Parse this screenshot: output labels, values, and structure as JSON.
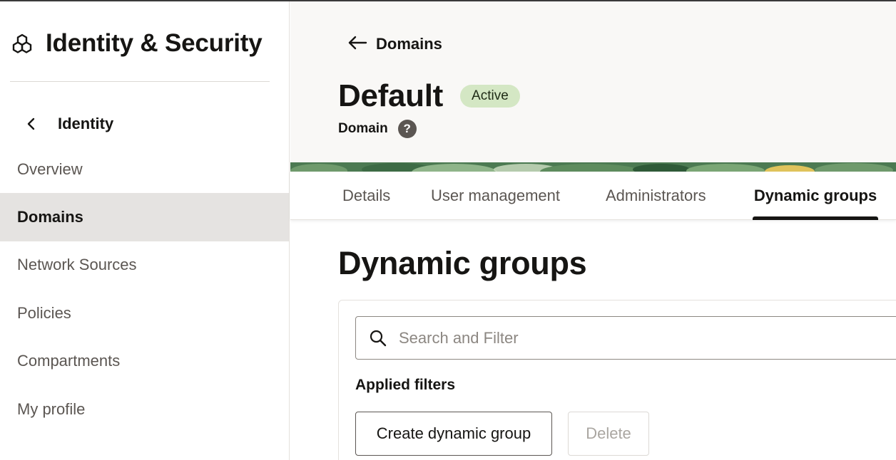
{
  "sidebar": {
    "brand_title": "Identity & Security",
    "brand_icon": "hexagon-cluster-icon",
    "back_label": "Identity",
    "items": [
      {
        "label": "Overview",
        "active": false
      },
      {
        "label": "Domains",
        "active": true
      },
      {
        "label": "Network Sources",
        "active": false
      },
      {
        "label": "Policies",
        "active": false
      },
      {
        "label": "Compartments",
        "active": false
      },
      {
        "label": "My profile",
        "active": false
      }
    ]
  },
  "header": {
    "back_link": "Domains",
    "title": "Default",
    "status": "Active",
    "subtitle": "Domain",
    "help_icon": "?"
  },
  "tabs": [
    {
      "label": "Details",
      "active": false
    },
    {
      "label": "User management",
      "active": false
    },
    {
      "label": "Administrators",
      "active": false
    },
    {
      "label": "Dynamic groups",
      "active": true
    }
  ],
  "section": {
    "title": "Dynamic groups",
    "search_placeholder": "Search and Filter",
    "applied_filters_label": "Applied filters",
    "create_button": "Create dynamic group",
    "delete_button": "Delete"
  },
  "colors": {
    "active_badge": "#d4e7c4",
    "active_nav_bg": "#e5e3e1",
    "header_bg": "#f9f8f6",
    "banner_green": "#4c7a52"
  }
}
